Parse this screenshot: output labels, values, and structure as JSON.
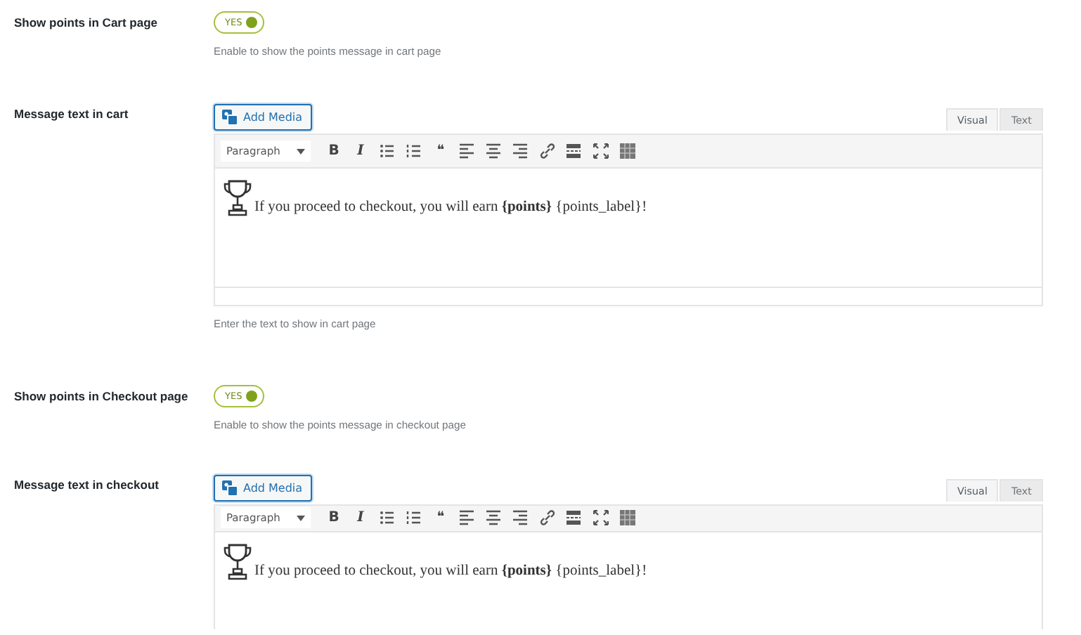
{
  "settings": [
    {
      "kind": "toggle",
      "label": "Show points in Cart page",
      "toggle": {
        "text": "YES",
        "on": true
      },
      "description": "Enable to show the points message in cart page"
    },
    {
      "kind": "editor",
      "label": "Message text in cart",
      "add_media": "Add Media",
      "tabs": [
        {
          "label": "Visual",
          "selected": true
        },
        {
          "label": "Text",
          "selected": false
        }
      ],
      "format": "Paragraph",
      "tools": [
        {
          "kind": "bold",
          "text": "B"
        },
        {
          "kind": "italic",
          "text": "I"
        },
        {
          "kind": "bullets"
        },
        {
          "kind": "numbers"
        },
        {
          "kind": "quote",
          "text": "❝"
        },
        {
          "kind": "align-left"
        },
        {
          "kind": "align-center"
        },
        {
          "kind": "align-right"
        },
        {
          "kind": "link"
        },
        {
          "kind": "more"
        },
        {
          "kind": "fullscreen"
        },
        {
          "kind": "kitchen"
        }
      ],
      "content": "If you proceed to checkout, you will earn **{points}** {points_label}!",
      "description": "Enter the text to show in cart page"
    },
    {
      "kind": "toggle",
      "label": "Show points in Checkout page",
      "toggle": {
        "text": "YES",
        "on": true
      },
      "description": "Enable to show the points message in checkout page"
    },
    {
      "kind": "editor",
      "label": "Message text in checkout",
      "add_media": "Add Media",
      "tabs": [
        {
          "label": "Visual",
          "selected": true
        },
        {
          "label": "Text",
          "selected": false
        }
      ],
      "format": "Paragraph",
      "tools": [
        {
          "kind": "bold",
          "text": "B"
        },
        {
          "kind": "italic",
          "text": "I"
        },
        {
          "kind": "bullets"
        },
        {
          "kind": "numbers"
        },
        {
          "kind": "quote",
          "text": "❝"
        },
        {
          "kind": "align-left"
        },
        {
          "kind": "align-center"
        },
        {
          "kind": "align-right"
        },
        {
          "kind": "link"
        },
        {
          "kind": "more"
        },
        {
          "kind": "fullscreen"
        },
        {
          "kind": "kitchen"
        }
      ],
      "content": "If you proceed to checkout, you will earn **{points}** {points_label}!"
    }
  ]
}
